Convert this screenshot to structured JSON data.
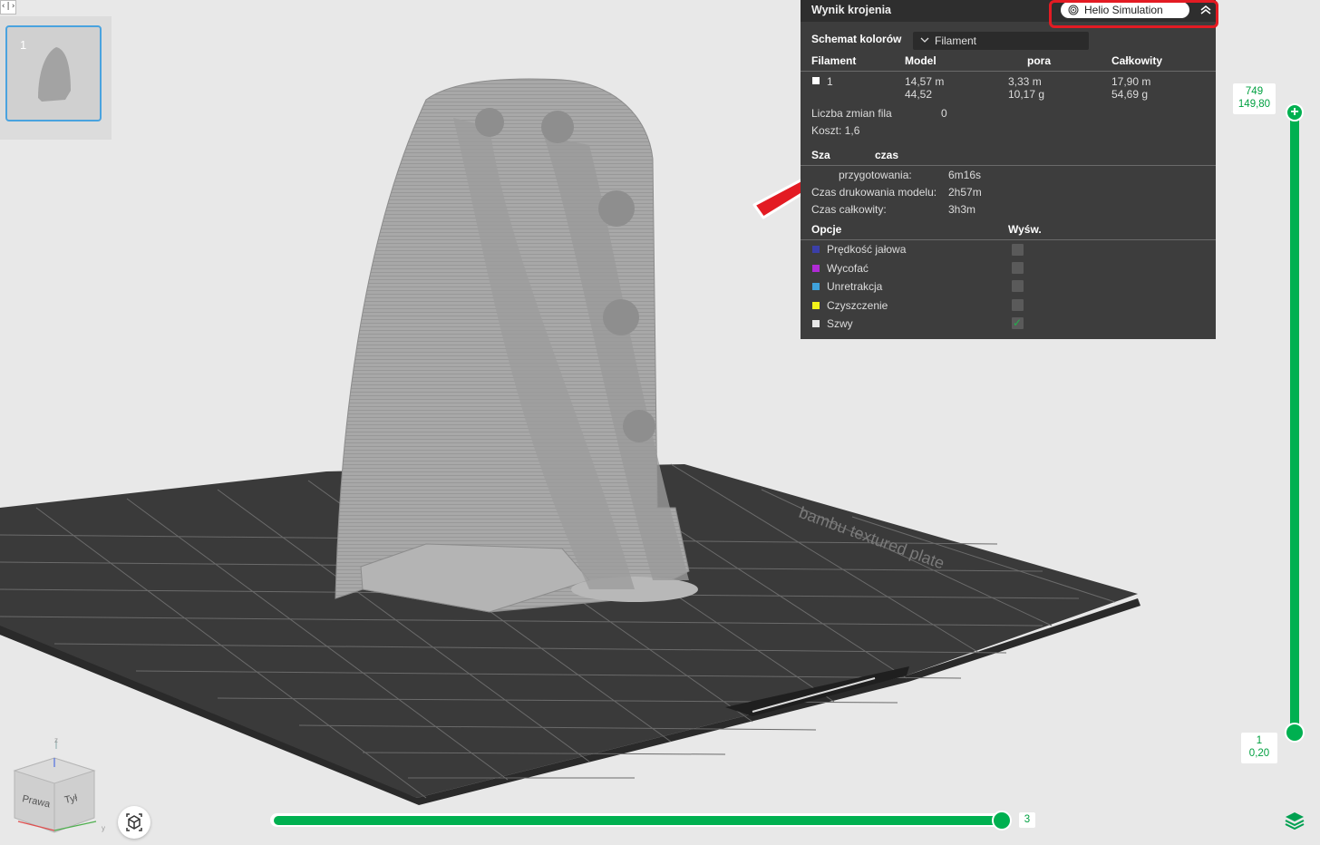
{
  "toggle_glyph": "‹|›",
  "plate": {
    "number": "1"
  },
  "panel": {
    "title": "Wynik krojenia",
    "helio_button": "Helio Simulation",
    "color_scheme_label": "Schemat kolorów",
    "color_scheme_value": "Filament",
    "table": {
      "headers": [
        "Filament",
        "Model",
        "pora",
        "Całkowity"
      ],
      "row": {
        "filament": "1",
        "model": [
          "14,57 m",
          "44,52"
        ],
        "support": [
          "3,33 m",
          "10,17 g"
        ],
        "total": [
          "17,90 m",
          "54,69 g"
        ]
      }
    },
    "filament_changes": "Liczba zmian fila",
    "filament_changes_value": "0",
    "cost": "Koszt:  1,6",
    "time_title": "Sza",
    "time_title_suffix": "czas",
    "times": [
      {
        "label": "przygotowania:",
        "value": "6m16s"
      },
      {
        "label": "Czas drukowania modelu:",
        "value": "2h57m"
      },
      {
        "label": "Czas całkowity:",
        "value": "3h3m"
      }
    ],
    "options_header": "Opcje",
    "display_header": "Wyśw.",
    "options": [
      {
        "label": "Prędkość jałowa",
        "color": "#3b3fa8",
        "checked": false
      },
      {
        "label": "Wycofać",
        "color": "#b02bd6",
        "checked": false
      },
      {
        "label": "Unretrakcja",
        "color": "#3fa2dc",
        "checked": false
      },
      {
        "label": "Czyszczenie",
        "color": "#f2f21a",
        "checked": false
      },
      {
        "label": "Szwy",
        "color": "#e8e8e8",
        "checked": true
      }
    ]
  },
  "layer_slider": {
    "top_label": [
      "749",
      "149,80"
    ],
    "bottom_label": [
      "1",
      "0,20"
    ],
    "top_icon": "+"
  },
  "move_slider": {
    "value": "3"
  },
  "nav_cube": {
    "face_right": "Prawa",
    "face_back": "Tył",
    "axis_z": "z",
    "axis_y": "y"
  },
  "colors": {
    "accent": "#00b050",
    "highlight": "#e31b23",
    "bed": "#3a3a3a",
    "model": "#a9a9a9"
  }
}
